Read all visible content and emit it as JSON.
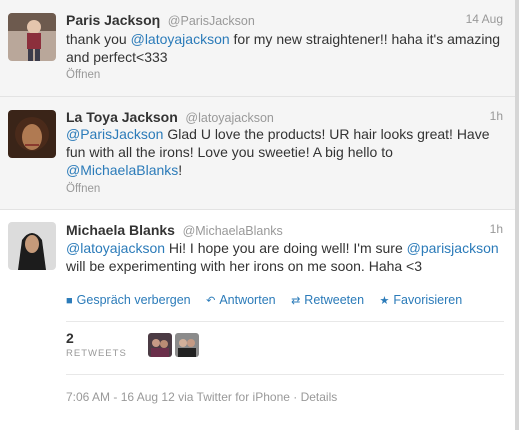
{
  "tweets": [
    {
      "fullname": "Paris Jacksοη",
      "handle": "@ParisJackson",
      "time": "14 Aug",
      "text_1": "thank you ",
      "mention_1": "@latoyajackson",
      "text_2": " for my new straightener!! haha it's amazing and perfect<333",
      "open": "Öffnen"
    },
    {
      "fullname": "La Toya Jackson",
      "handle": "@latoyajackson",
      "time": "1h",
      "mention_1": "@ParisJackson",
      "text_1": " Glad U love the products! UR hair looks great! Have fun with all the irons! Love you sweetie! A big hello to ",
      "mention_2": "@MichaelaBlanks",
      "text_2": "!",
      "open": "Öffnen"
    },
    {
      "fullname": "Michaela Blanks",
      "handle": "@MichaelaBlanks",
      "time": "1h",
      "mention_1": "@latoyajackson",
      "text_1": " Hi! I hope you are doing well! I'm sure ",
      "mention_2": "@parisjackson",
      "text_2": " will be experimenting with her irons on me soon. Haha <3",
      "actions": {
        "conversation": "Gespräch verbergen",
        "reply": "Antworten",
        "retweet": "Retweeten",
        "favorite": "Favorisieren"
      },
      "retweet_count": "2",
      "retweets_label": "RETWEETS",
      "meta": "7:06 AM - 16 Aug 12 via Twitter for iPhone · Details"
    }
  ],
  "icons": {
    "conversation": "speech-bubble-icon",
    "reply": "reply-arrow-icon",
    "retweet": "retweet-icon",
    "favorite": "star-icon"
  },
  "colors": {
    "link": "#2b7bb9",
    "muted": "#999999",
    "text": "#333333",
    "background_read": "#f5f5f5"
  }
}
